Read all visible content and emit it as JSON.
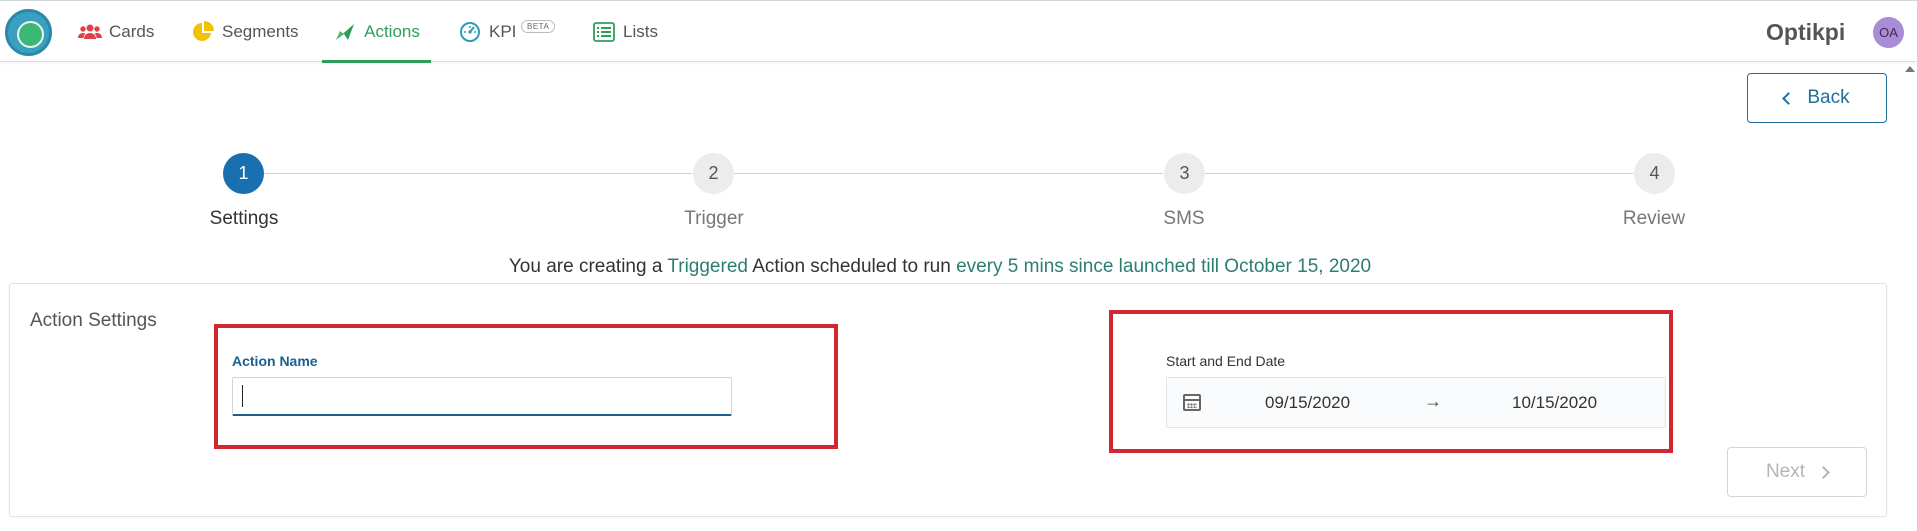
{
  "nav": {
    "items": [
      {
        "label": "Cards",
        "icon": "users-icon"
      },
      {
        "label": "Segments",
        "icon": "pie-chart-icon"
      },
      {
        "label": "Actions",
        "icon": "send-icon",
        "active": true
      },
      {
        "label": "KPI",
        "icon": "speedometer-icon",
        "badge": "BETA"
      },
      {
        "label": "Lists",
        "icon": "list-icon"
      }
    ],
    "brand": "Optikpi",
    "avatar_initials": "OA"
  },
  "back_label": "Back",
  "stepper": {
    "steps": [
      {
        "number": "1",
        "label": "Settings",
        "active": true
      },
      {
        "number": "2",
        "label": "Trigger"
      },
      {
        "number": "3",
        "label": "SMS"
      },
      {
        "number": "4",
        "label": "Review"
      }
    ]
  },
  "summary": {
    "prefix": "You are creating a",
    "type": "Triggered",
    "middle": "Action scheduled to run",
    "schedule": "every 5 mins since launched till October 15, 2020"
  },
  "settings": {
    "title": "Action Settings",
    "action_name_label": "Action Name",
    "action_name_value": "",
    "date_label": "Start and End Date",
    "start_date": "09/15/2020",
    "arrow": "→",
    "end_date": "10/15/2020"
  },
  "next_label": "Next",
  "colors": {
    "accent_green": "#2e9e57",
    "primary_blue": "#1a6fae",
    "highlight_teal": "#2c7d73",
    "annotation_red": "#d22630"
  }
}
